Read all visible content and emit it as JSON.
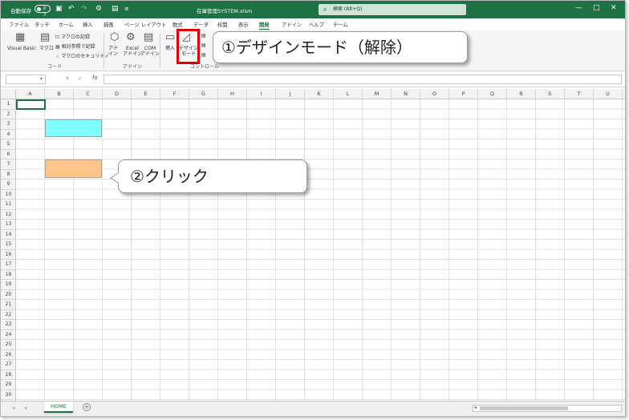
{
  "titlebar": {
    "autosave_label": "自動保存",
    "autosave_state": "オフ",
    "filename": "在庫管理SYSTEM.xlsm",
    "search_placeholder": "検索 (Alt+Q)"
  },
  "tabs": [
    "ファイル",
    "タッチ",
    "ホーム",
    "挿入",
    "描画",
    "ページ レイアウト",
    "数式",
    "データ",
    "校閲",
    "表示",
    "開発",
    "アドイン",
    "ヘルプ",
    "チーム"
  ],
  "active_tab": "開発",
  "ribbon": {
    "visual_basic": "Visual Basic",
    "macro": "マクロ",
    "record_macro": "マクロの記録",
    "relative_ref": "相対参照で記録",
    "macro_security": "マクロのセキュリティ",
    "group_code": "コード",
    "addins": "アド\nイン",
    "excel_addins": "Excel\nアドイン",
    "com_addins": "COM\nアドイン",
    "group_addins": "アドイン",
    "insert": "挿入",
    "design_mode": "デザイン\nモード",
    "group_controls": "コントロール"
  },
  "formula_bar": {
    "fx": "fx",
    "cancel": "✕",
    "enter": "✓"
  },
  "columns": [
    "A",
    "B",
    "C",
    "D",
    "E",
    "F",
    "G",
    "H",
    "I",
    "J",
    "K",
    "L",
    "M",
    "N",
    "O",
    "P",
    "Q",
    "R",
    "S",
    "T",
    "U"
  ],
  "rows": [
    "1",
    "2",
    "3",
    "4",
    "5",
    "6",
    "7",
    "8",
    "9",
    "10",
    "11",
    "12",
    "13",
    "14",
    "15",
    "16",
    "17",
    "18",
    "19",
    "20",
    "21",
    "22",
    "23",
    "24",
    "25",
    "26",
    "27",
    "28",
    "29",
    "30"
  ],
  "sheet_tab": "HOME",
  "callouts": {
    "step1": "①デザインモード（解除）",
    "step2": "②クリック"
  },
  "colors": {
    "excel_green": "#1e7145",
    "button_cyan": "#80ffff",
    "button_orange": "#ffc58a",
    "highlight_red": "#e00000"
  }
}
